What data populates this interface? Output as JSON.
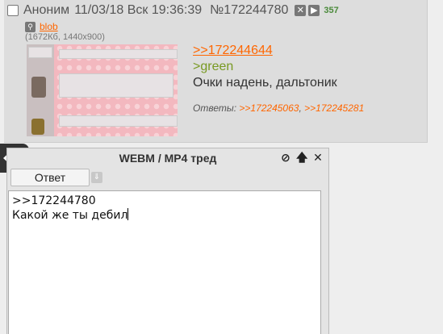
{
  "post": {
    "author": "Аноним",
    "date": "11/03/18 Вск 19:36:39",
    "number": "№172244780",
    "reply_count": "357",
    "file_name": "blob",
    "file_meta": "(1672Кб, 1440x900)",
    "quote": ">>172244644",
    "greentext": ">green",
    "message": "Очки надень, дальтоник",
    "replies_label": "Ответы:",
    "replies": [
      ">>172245063",
      ">>172245281"
    ],
    "reply_separator": ","
  },
  "reply_form": {
    "title": "WEBM / MP4 тред",
    "answer_label": "Ответ",
    "text_line1": ">>172244780",
    "text_line2": "Какой же ты дебил"
  },
  "colors": {
    "link": "#ff6600",
    "greentext": "#789922",
    "counter": "#4a8a3a"
  }
}
